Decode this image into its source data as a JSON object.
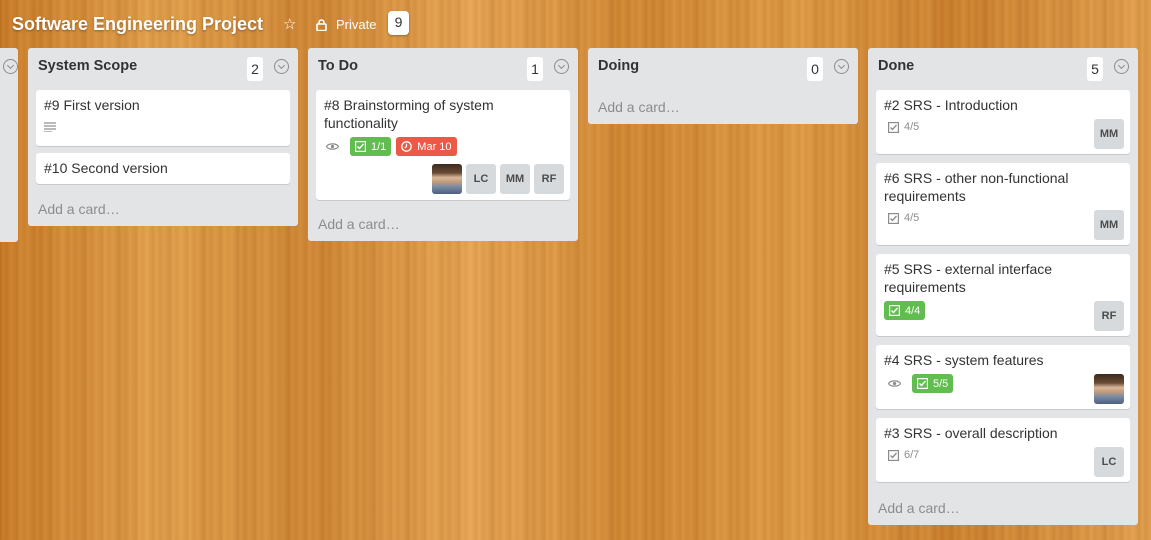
{
  "board": {
    "title": "Software Engineering Project",
    "visibility": "Private",
    "count": "9"
  },
  "lists": [
    {
      "title": "System Scope",
      "count": "2",
      "add_card": "Add a card…",
      "cards": [
        {
          "title": "#9 First version"
        },
        {
          "title": "#10 Second version"
        }
      ]
    },
    {
      "title": "To Do",
      "count": "1",
      "add_card": "Add a card…",
      "cards": [
        {
          "title": "#8 Brainstorming of system functionality",
          "checklist": "1/1",
          "due": "Mar 10",
          "members": [
            "LC",
            "MM",
            "RF"
          ]
        }
      ]
    },
    {
      "title": "Doing",
      "count": "0",
      "add_card": "Add a card…",
      "cards": []
    },
    {
      "title": "Done",
      "count": "5",
      "add_card": "Add a card…",
      "cards": [
        {
          "title": "#2 SRS - Introduction",
          "checklist": "4/5",
          "members": [
            "MM"
          ]
        },
        {
          "title": "#6 SRS - other non-functional requirements",
          "checklist": "4/5",
          "members": [
            "MM"
          ]
        },
        {
          "title": "#5 SRS - external interface requirements",
          "checklist": "4/4",
          "members": [
            "RF"
          ]
        },
        {
          "title": "#4 SRS - system features",
          "checklist": "5/5"
        },
        {
          "title": "#3 SRS - overall description",
          "checklist": "6/7",
          "members": [
            "LC"
          ]
        }
      ]
    }
  ],
  "colors": {
    "green_badge": "#61bd4f",
    "red_badge": "#eb5a46",
    "list_bg": "#e2e4e6"
  },
  "icons": [
    "star-icon",
    "lock-icon",
    "chevron-down-icon",
    "description-icon",
    "eye-icon",
    "checklist-icon",
    "clock-icon"
  ]
}
